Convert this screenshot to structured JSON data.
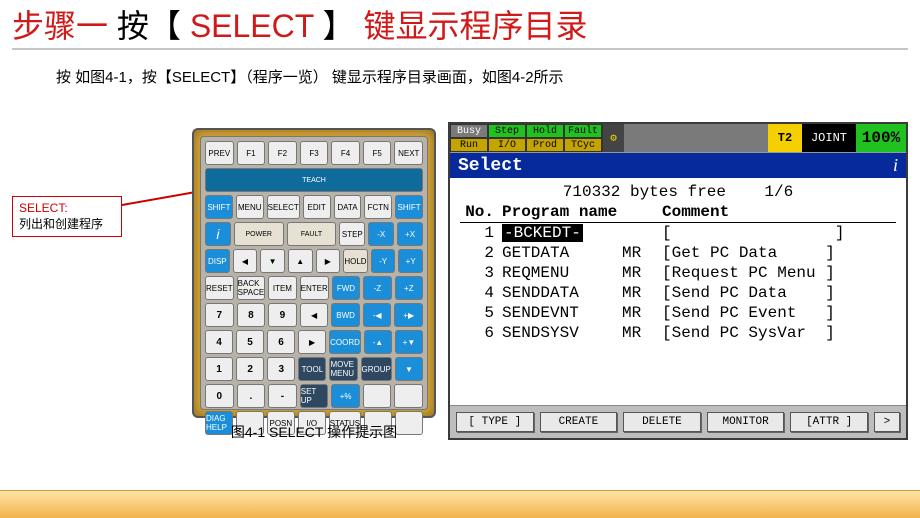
{
  "title": {
    "part1": "步骤一",
    "part2": "  按【",
    "select": "SELECT",
    "part3": "】",
    "part4": "键显示程序目录"
  },
  "intro": "按 如图4-1，按【SELECT】（程序一览） 键显示程序目录画面，如图4-2所示",
  "annotation": {
    "label": "SELECT:",
    "body": "列出和创建程序"
  },
  "pendant": {
    "caption": "图4-1 SELECT 操作提示图",
    "row_top": [
      "PREV",
      "F1",
      "F2",
      "F3",
      "F4",
      "F5",
      "NEXT"
    ],
    "row_teach_label": "TEACH",
    "row2": [
      "SHIFT",
      "MENU",
      "SELECT",
      "EDIT",
      "DATA",
      "FCTN",
      "SHIFT"
    ],
    "leds": [
      "POWER",
      "FAULT"
    ],
    "row3_left": [
      "DISP",
      "◀",
      "▼",
      "▲",
      "▶"
    ],
    "row3_right_top": [
      "STEP",
      "-X",
      "+X"
    ],
    "row3_right_bot": [
      "HOLD",
      "-Y",
      "+Y"
    ],
    "row4": [
      "RESET",
      "BACK SPACE",
      "ITEM",
      "ENTER",
      "FWD",
      "-Z",
      "+Z"
    ],
    "row5": [
      "7",
      "8",
      "9",
      "◀",
      "BWD",
      "-◀",
      "+▶"
    ],
    "row6": [
      "4",
      "5",
      "6",
      "▶",
      "COORD",
      "-▲",
      "+▼"
    ],
    "row7": [
      "1",
      "2",
      "3",
      "TOOL",
      "MOVE MENU",
      "GROUP",
      "▼"
    ],
    "row8": [
      "0",
      ".",
      "-",
      "SET UP",
      "+%",
      "",
      ""
    ],
    "row9": [
      "DIAG HELP",
      "",
      "POSN",
      "I/O",
      "STATUS",
      "",
      ""
    ]
  },
  "screen": {
    "status_top": [
      "Busy",
      "Step",
      "Hold",
      "Fault"
    ],
    "status_bot": [
      "Run",
      "I/O",
      "Prod",
      "TCyc"
    ],
    "io_glyph": "⚙",
    "t2": "T2",
    "joint": "JOINT",
    "pct": "100%",
    "title": "Select",
    "info": "i",
    "bytes": "710332 bytes free",
    "page": "1/6",
    "cols": {
      "no": "No.",
      "name": "Program name",
      "comment": "Comment"
    },
    "rows": [
      {
        "no": "1",
        "name": "-BCKEDT-",
        "type": "",
        "comment": "[                 ]",
        "selected": true
      },
      {
        "no": "2",
        "name": "GETDATA",
        "type": "MR",
        "comment": "[Get PC Data     ]"
      },
      {
        "no": "3",
        "name": "REQMENU",
        "type": "MR",
        "comment": "[Request PC Menu ]"
      },
      {
        "no": "4",
        "name": "SENDDATA",
        "type": "MR",
        "comment": "[Send PC Data    ]"
      },
      {
        "no": "5",
        "name": "SENDEVNT",
        "type": "MR",
        "comment": "[Send PC Event   ]"
      },
      {
        "no": "6",
        "name": "SENDSYSV",
        "type": "MR",
        "comment": "[Send PC SysVar  ]"
      }
    ],
    "softkeys": [
      "[ TYPE ]",
      "CREATE",
      "DELETE",
      "MONITOR",
      "[ATTR ]",
      ">"
    ]
  }
}
